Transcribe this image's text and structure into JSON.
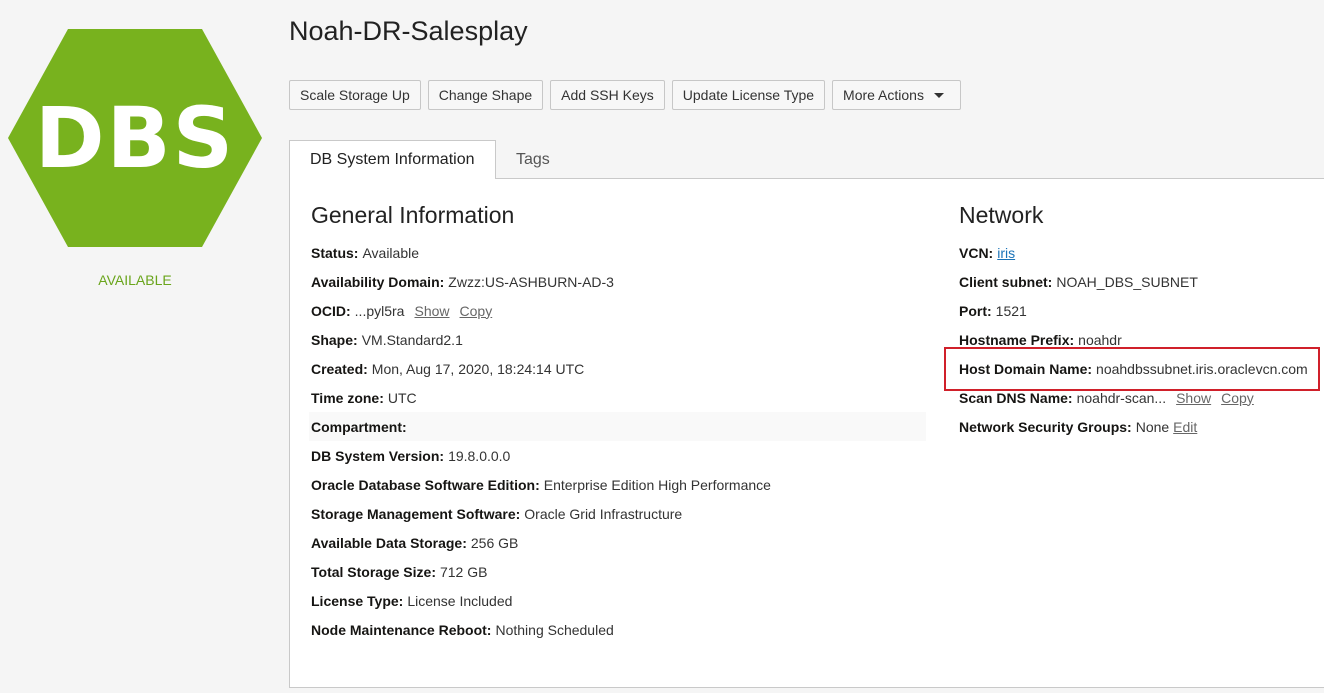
{
  "resource": {
    "icon_text": "DBS",
    "icon_color": "#78b21e",
    "state": "AVAILABLE",
    "state_color": "#6aa51c"
  },
  "page": {
    "title": "Noah-DR-Salesplay"
  },
  "toolbar": {
    "scale_storage": "Scale Storage Up",
    "change_shape": "Change Shape",
    "add_ssh_keys": "Add SSH Keys",
    "update_license": "Update License Type",
    "more_actions": "More Actions"
  },
  "tabs": {
    "info": "DB System Information",
    "tags": "Tags"
  },
  "general": {
    "title": "General Information",
    "status_label": "Status:",
    "status_value": "Available",
    "ad_label": "Availability Domain:",
    "ad_value": "Zwzz:US-ASHBURN-AD-3",
    "ocid_label": "OCID:",
    "ocid_value": "...pyl5ra",
    "ocid_show": "Show",
    "ocid_copy": "Copy",
    "shape_label": "Shape:",
    "shape_value": "VM.Standard2.1",
    "created_label": "Created:",
    "created_value": "Mon, Aug 17, 2020, 18:24:14 UTC",
    "tz_label": "Time zone:",
    "tz_value": "UTC",
    "compartment_label": "Compartment:",
    "version_label": "DB System Version:",
    "version_value": "19.8.0.0.0",
    "edition_label": "Oracle Database Software Edition:",
    "edition_value": "Enterprise Edition High Performance",
    "storage_mgmt_label": "Storage Management Software:",
    "storage_mgmt_value": "Oracle Grid Infrastructure",
    "avail_storage_label": "Available Data Storage:",
    "avail_storage_value": "256 GB",
    "total_storage_label": "Total Storage Size:",
    "total_storage_value": "712 GB",
    "license_label": "License Type:",
    "license_value": "License Included",
    "maint_label": "Node Maintenance Reboot:",
    "maint_value": "Nothing Scheduled"
  },
  "network": {
    "title": "Network",
    "vcn_label": "VCN:",
    "vcn_value": "iris",
    "subnet_label": "Client subnet:",
    "subnet_value": "NOAH_DBS_SUBNET",
    "port_label": "Port:",
    "port_value": "1521",
    "hostname_label": "Hostname Prefix:",
    "hostname_value": "noahdr",
    "domain_label": "Host Domain Name:",
    "domain_value": "noahdbssubnet.iris.oraclevcn.com",
    "scan_label": "Scan DNS Name:",
    "scan_value": "noahdr-scan...",
    "scan_show": "Show",
    "scan_copy": "Copy",
    "nsg_label": "Network Security Groups:",
    "nsg_value": "None",
    "nsg_edit": "Edit"
  }
}
